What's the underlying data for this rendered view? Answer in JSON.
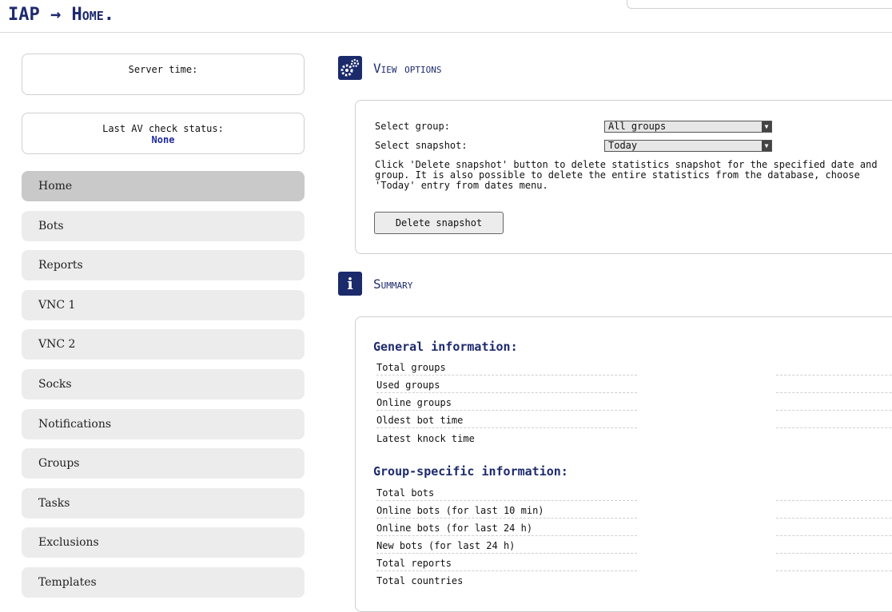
{
  "header": {
    "title": "IAP → Home."
  },
  "server_time": {
    "label": "Server time:",
    "value": ""
  },
  "av_status": {
    "label": "Last AV check status:",
    "value": "None"
  },
  "nav": {
    "items": [
      {
        "label": "Home",
        "active": true
      },
      {
        "label": "Bots"
      },
      {
        "label": "Reports"
      },
      {
        "label": "VNC 1"
      },
      {
        "label": "VNC 2"
      },
      {
        "label": "Socks"
      },
      {
        "label": "Notifications"
      },
      {
        "label": "Groups"
      },
      {
        "label": "Tasks"
      },
      {
        "label": "Exclusions"
      },
      {
        "label": "Templates"
      }
    ]
  },
  "view_options": {
    "title": "View options",
    "icon": "gears-icon",
    "group_label": "Select group:",
    "group_value": "All groups",
    "snapshot_label": "Select snapshot:",
    "snapshot_value": "Today",
    "help": "Click 'Delete snapshot' button to delete statistics snapshot for the specified date and\ngroup. It is also possible to delete the entire statistics from the database, choose\n'Today' entry from dates menu.",
    "delete_button": "Delete snapshot"
  },
  "summary": {
    "title": "Summary",
    "icon": "info-icon",
    "general_heading": "General information:",
    "general_rows": [
      "Total groups",
      "Used groups",
      "Online groups",
      "Oldest bot time",
      "Latest knock time"
    ],
    "group_heading": "Group-specific information:",
    "group_rows": [
      "Total bots",
      "Online bots (for last 10 min)",
      "Online bots (for last 24 h)",
      "New bots (for last 24 h)",
      "Total reports",
      "Total countries"
    ]
  },
  "colors": {
    "accent": "#1e2a6e",
    "nav_active": "#c9c9c9",
    "nav_bg": "#ececec"
  }
}
